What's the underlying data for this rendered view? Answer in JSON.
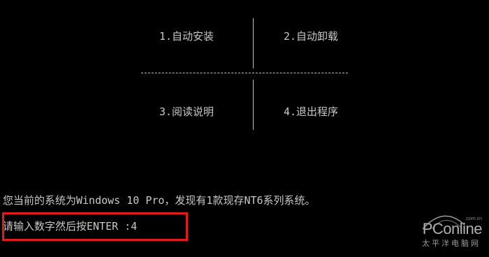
{
  "menu": {
    "item1": "1.自动安装",
    "item2": "2.自动卸载",
    "item3": "3.阅读说明",
    "item4": "4.退出程序",
    "separator": "----------------------------------------"
  },
  "status_line": "您当前的系统为Windows 10 Pro，发现有1款现存NT6系列系统。",
  "prompt": {
    "text": "请输入数字然后按ENTER :",
    "value": "4"
  },
  "highlight_color": "#e21a1a",
  "watermark": {
    "brand": "PConline",
    "domain": ".com.cn",
    "tagline": "太平洋电脑网"
  }
}
